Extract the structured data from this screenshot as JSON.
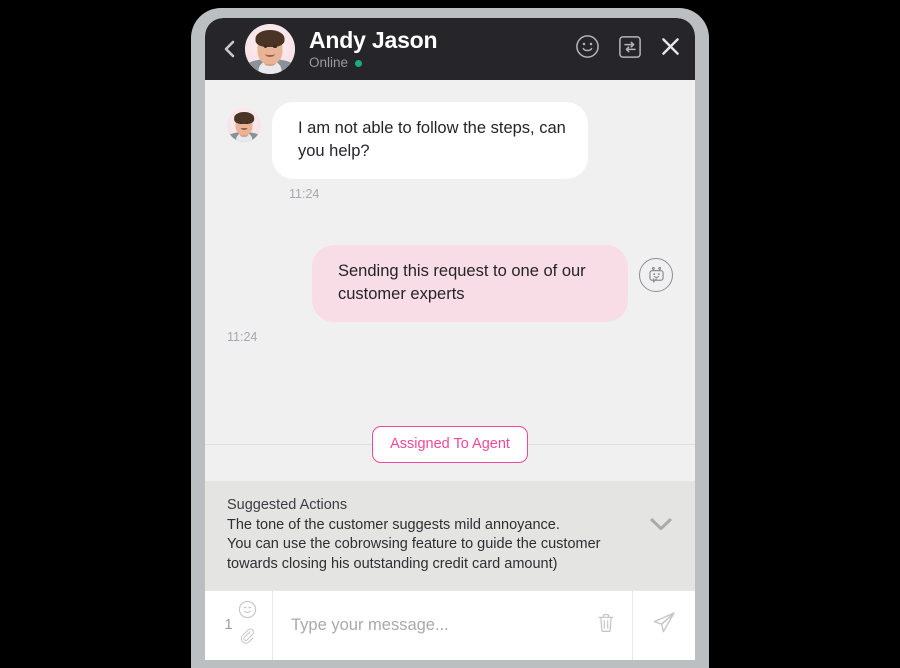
{
  "header": {
    "name": "Andy Jason",
    "status": "Online",
    "back_icon": "chevron-left-icon",
    "avatar_icon": "user-avatar",
    "status_dot_color": "#15b077",
    "actions": [
      {
        "icon": "smiley-face-icon",
        "label": "Emoji"
      },
      {
        "icon": "transfer-chat-icon",
        "label": "Transfer"
      },
      {
        "icon": "close-icon",
        "label": "Close"
      }
    ],
    "background_color": "#26262a"
  },
  "conversation": {
    "messages": [
      {
        "direction": "inbound",
        "avatar_icon": "customer-avatar",
        "text": "I am not able to follow the steps, can you help?",
        "time": "11:24",
        "bubble_color": "#ffffff"
      },
      {
        "direction": "outbound",
        "avatar_icon": "bot-avatar-icon",
        "text": "Sending this request to one of our customer experts",
        "time": "11:24",
        "bubble_color": "#f9dde6"
      }
    ],
    "system_badge": {
      "label": "Assigned To Agent",
      "color": "#f4469a"
    },
    "background_color": "#f0f0f1"
  },
  "suggested_actions": {
    "title": "Suggested Actions",
    "lines": [
      "The tone of the customer suggests mild annoyance.",
      "You can use the cobrowsing feature to guide the customer",
      "towards closing his outstanding credit card amount)"
    ],
    "collapse_icon": "chevron-down-icon",
    "background_color": "#e4e4e3"
  },
  "composer": {
    "count": "1",
    "emoji_icon": "smiley-face-icon",
    "attach_icon": "paperclip-icon",
    "placeholder": "Type your message...",
    "value": "",
    "delete_icon": "trash-icon",
    "send_icon": "paper-plane-icon"
  }
}
